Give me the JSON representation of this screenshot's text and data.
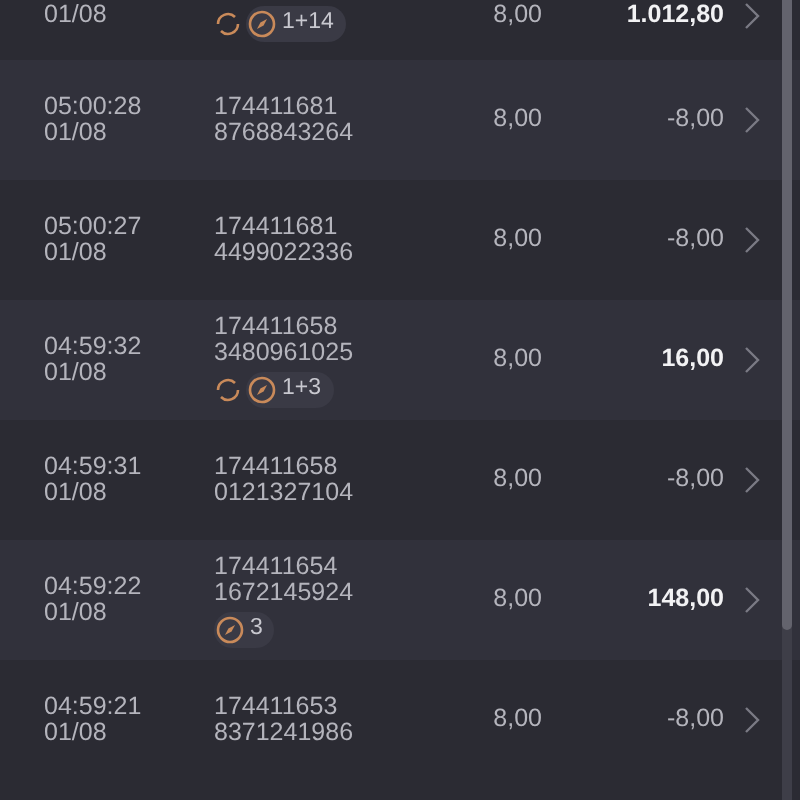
{
  "rows": [
    {
      "time": null,
      "date": "01/08",
      "id_lines": [],
      "stake": "8,00",
      "amount": "1.012,80",
      "highlight": true,
      "badges": {
        "refresh": true,
        "count": "1+14"
      }
    },
    {
      "time": "05:00:28",
      "date": "01/08",
      "id_lines": [
        "174411681",
        "8768843264"
      ],
      "stake": "8,00",
      "amount": "-8,00",
      "highlight": false
    },
    {
      "time": "05:00:27",
      "date": "01/08",
      "id_lines": [
        "174411681",
        "4499022336"
      ],
      "stake": "8,00",
      "amount": "-8,00",
      "highlight": false
    },
    {
      "time": "04:59:32",
      "date": "01/08",
      "id_lines": [
        "174411658",
        "3480961025"
      ],
      "stake": "8,00",
      "amount": "16,00",
      "highlight": true,
      "badges": {
        "refresh": true,
        "count": "1+3"
      }
    },
    {
      "time": "04:59:31",
      "date": "01/08",
      "id_lines": [
        "174411658",
        "0121327104"
      ],
      "stake": "8,00",
      "amount": "-8,00",
      "highlight": false
    },
    {
      "time": "04:59:22",
      "date": "01/08",
      "id_lines": [
        "174411654",
        "1672145924"
      ],
      "stake": "8,00",
      "amount": "148,00",
      "highlight": true,
      "badges": {
        "refresh": false,
        "count": "3"
      }
    },
    {
      "time": "04:59:21",
      "date": "01/08",
      "id_lines": [
        "174411653",
        "8371241986"
      ],
      "stake": "8,00",
      "amount": "-8,00",
      "highlight": false
    }
  ]
}
